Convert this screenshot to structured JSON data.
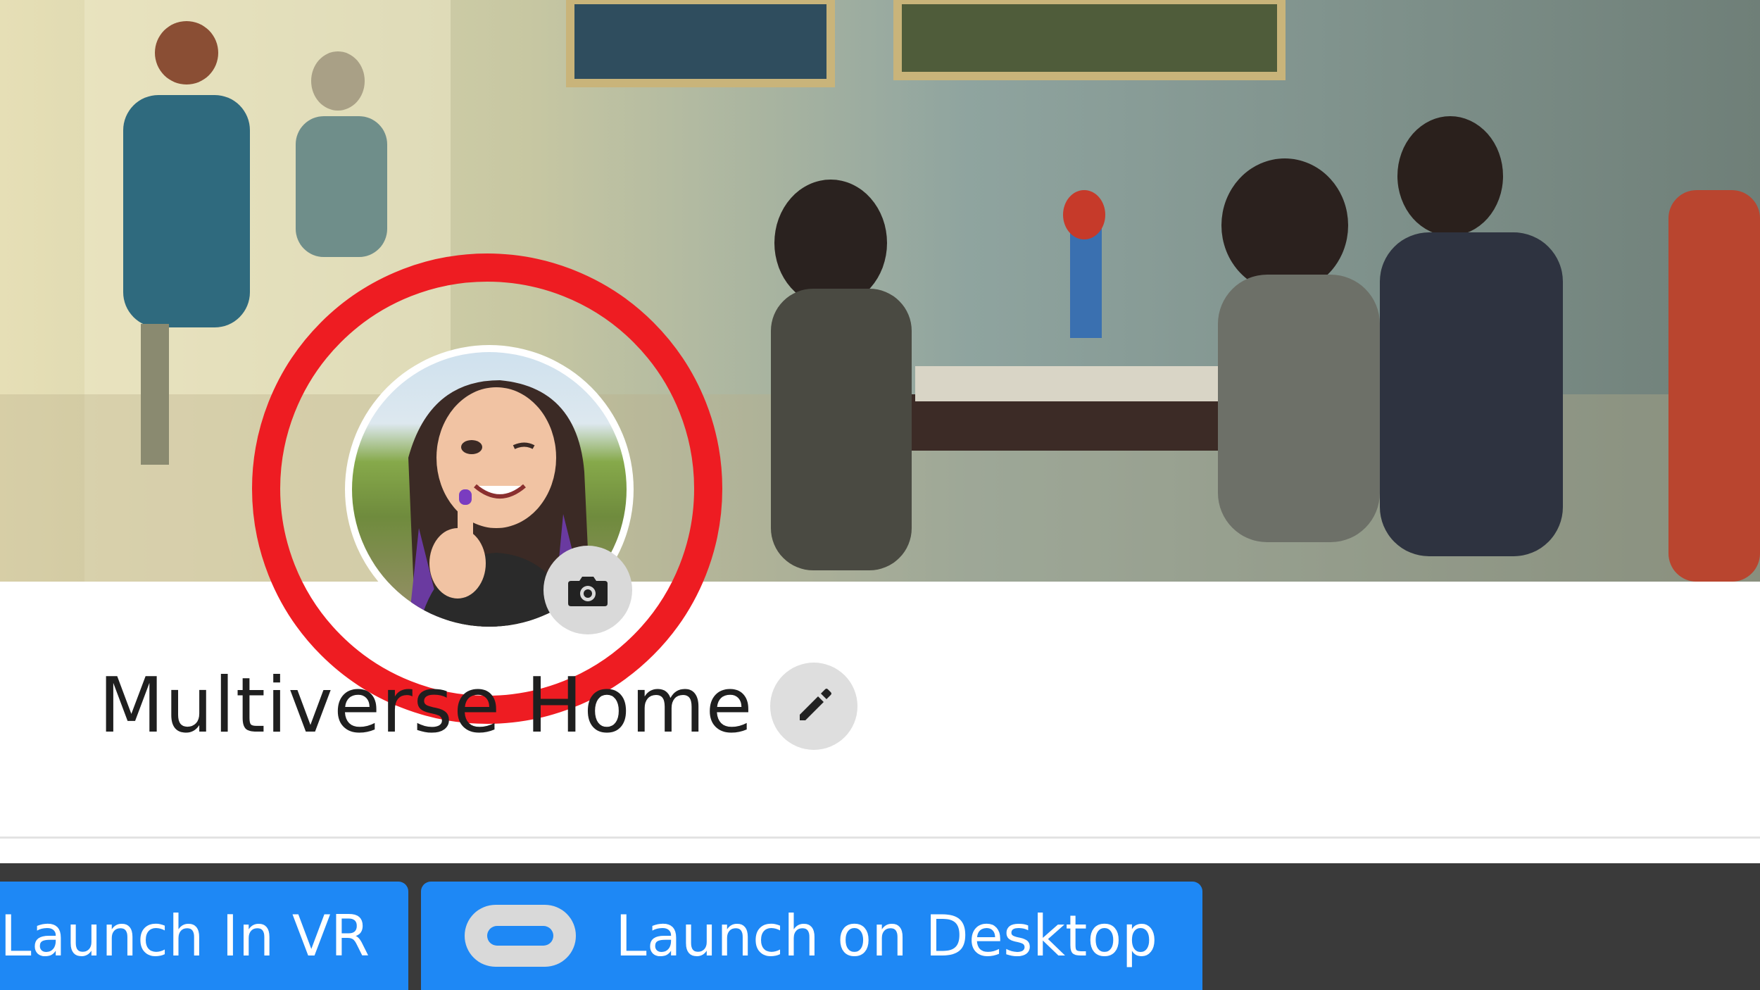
{
  "profile": {
    "page_name": "Multiverse Home"
  },
  "actions": {
    "launch_vr_label": "Launch In VR",
    "launch_desktop_label": "Launch on Desktop"
  },
  "icons": {
    "edit": "pencil-icon",
    "camera": "camera-icon",
    "headset": "vr-headset-icon"
  },
  "colors": {
    "accent_blue": "#1e88f5",
    "highlight_red": "#ee1c22",
    "toolbar_dark": "#3a3a3a"
  }
}
